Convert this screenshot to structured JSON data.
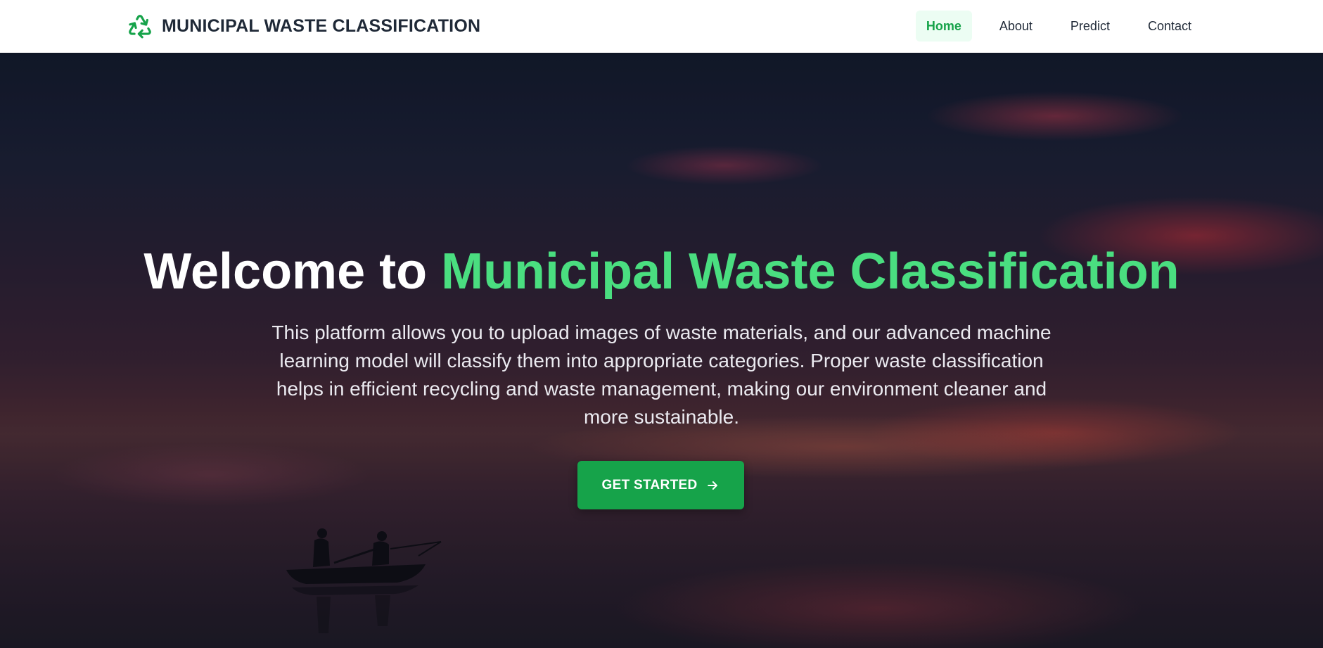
{
  "navbar": {
    "brand": {
      "icon": "recycle-icon",
      "title": "MUNICIPAL WASTE CLASSIFICATION"
    },
    "items": [
      {
        "label": "Home",
        "active": true
      },
      {
        "label": "About",
        "active": false
      },
      {
        "label": "Predict",
        "active": false
      },
      {
        "label": "Contact",
        "active": false
      }
    ]
  },
  "hero": {
    "title_prefix": "Welcome to",
    "title_highlight": "Municipal Waste Classification",
    "description": "This platform allows you to upload images of waste materials, and our advanced machine learning model will classify them into appropriate categories. Proper waste classification helps in efficient recycling and waste management, making our environment cleaner and more sustainable.",
    "cta_label": "GET STARTED",
    "cta_icon": "arrow-right-icon",
    "background": "sunset-lake-boat-photo"
  },
  "colors": {
    "accent": "#16a34a",
    "highlight": "#4ade80",
    "nav_active_bg": "#ecfdf3",
    "text_dark": "#1f2937"
  }
}
